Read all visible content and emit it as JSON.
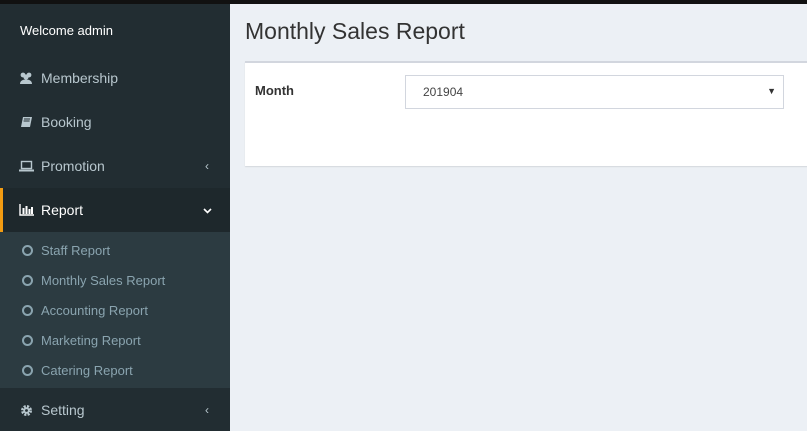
{
  "sidebar": {
    "welcome": "Welcome admin",
    "items": [
      {
        "label": "Membership",
        "icon": "users-icon"
      },
      {
        "label": "Booking",
        "icon": "book-icon"
      },
      {
        "label": "Promotion",
        "icon": "laptop-icon"
      },
      {
        "label": "Report",
        "icon": "bar-chart-icon"
      },
      {
        "label": "Setting",
        "icon": "gear-icon"
      }
    ],
    "report_submenu": [
      "Staff Report",
      "Monthly Sales Report",
      "Accounting Report",
      "Marketing Report",
      "Catering Report"
    ],
    "active_accent": "#f39c12"
  },
  "main": {
    "title": "Monthly Sales Report",
    "month_label": "Month",
    "month_value": "201904"
  }
}
